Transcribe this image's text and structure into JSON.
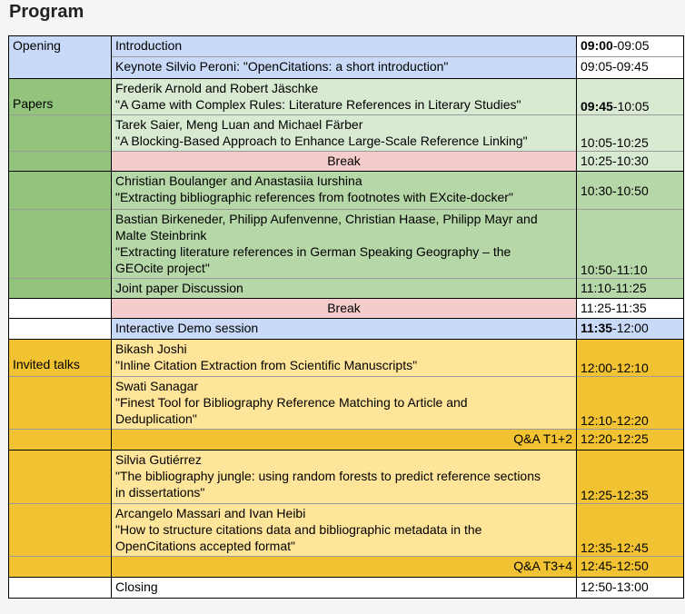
{
  "page_title": "Program",
  "sections": {
    "opening": "Opening",
    "papers": "Papers",
    "invited": "Invited talks"
  },
  "rows": {
    "intro": {
      "title": "Introduction",
      "time_start": "09:00",
      "time_end": "-09:05"
    },
    "keynote": {
      "title": "Keynote Silvio Peroni: \"OpenCitations: a short introduction\"",
      "time": "09:05-09:45"
    },
    "p1": {
      "authors": "Frederik Arnold and Robert Jäschke",
      "title": "\"A Game with Complex Rules: Literature References in Literary Studies\"",
      "time_start": "09:45",
      "time_end": "-10:05"
    },
    "p2": {
      "authors": "Tarek Saier, Meng Luan and Michael Färber",
      "title": "\"A Blocking-Based Approach to Enhance Large-Scale Reference Linking\"",
      "time": "10:05-10:25"
    },
    "break1": {
      "label": "Break",
      "time": "10:25-10:30"
    },
    "p3": {
      "authors": "Christian Boulanger and Anastasiia Iurshina",
      "title": "\"Extracting bibliographic references from footnotes with EXcite-docker\"",
      "time": "10:30-10:50"
    },
    "p4": {
      "authors_l1": "Bastian Birkeneder, Philipp Aufenvenne, Christian Haase, Philipp Mayr and",
      "authors_l2": "Malte Steinbrink",
      "title_l1": "\"Extracting literature references in German Speaking Geography – the",
      "title_l2": "GEOcite project\"",
      "time": "10:50-11:10"
    },
    "discussion": {
      "title": "Joint paper Discussion",
      "time": "11:10-11:25"
    },
    "break2": {
      "label": "Break",
      "time": "11:25-11:35"
    },
    "demo": {
      "title": "Interactive Demo session",
      "time_start": "11:35",
      "time_end": "-12:00"
    },
    "t1": {
      "authors": "Bikash Joshi",
      "title": "\"Inline Citation Extraction from Scientific Manuscripts\"",
      "time": "12:00-12:10"
    },
    "t2": {
      "authors": "Swati Sanagar",
      "title_l1": "\"Finest Tool for Bibliography Reference Matching to Article and",
      "title_l2": "Deduplication\"",
      "time": "12:10-12:20"
    },
    "qa1": {
      "label": "Q&A T1+2",
      "time": "12:20-12:25"
    },
    "t3": {
      "authors": "Silvia Gutiérrez",
      "title_l1": "\"The bibliography jungle: using random forests to predict reference sections",
      "title_l2": "in dissertations\"",
      "time": "12:25-12:35"
    },
    "t4": {
      "authors": "Arcangelo Massari and Ivan Heibi",
      "title_l1": "\"How to structure citations data and bibliographic metadata in the",
      "title_l2": "OpenCitations accepted format\"",
      "time": "12:35-12:45"
    },
    "qa2": {
      "label": "Q&A T3+4",
      "time": "12:45-12:50"
    },
    "closing": {
      "title": "Closing",
      "time": "12:50-13:00"
    }
  }
}
